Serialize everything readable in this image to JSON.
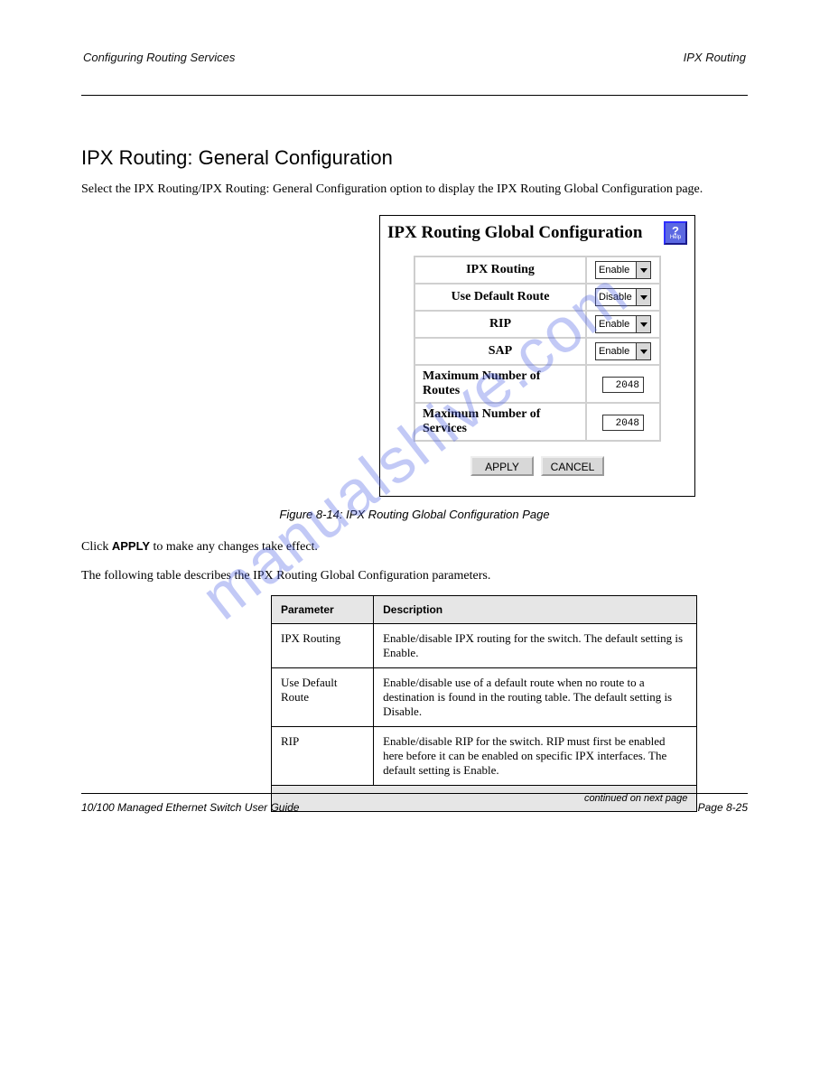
{
  "header": {
    "left": "Configuring Routing Services",
    "right": "IPX Routing"
  },
  "section_heading": "IPX Routing: General Configuration",
  "intro": "Select the IPX Routing/IPX Routing: General Configuration option to display the IPX Routing Global Configuration page.",
  "ui": {
    "title": "IPX Routing Global Configuration",
    "help_icon": "?",
    "help_label": "Help",
    "rows": [
      {
        "label": "IPX Routing",
        "kind": "select",
        "value": "Enable"
      },
      {
        "label": "Use Default Route",
        "kind": "select",
        "value": "Disable"
      },
      {
        "label": "RIP",
        "kind": "select",
        "value": "Enable"
      },
      {
        "label": "SAP",
        "kind": "select",
        "value": "Enable"
      },
      {
        "label": "Maximum Number of Routes",
        "kind": "input",
        "value": "2048"
      },
      {
        "label": "Maximum Number of Services",
        "kind": "input",
        "value": "2048"
      }
    ],
    "apply_label": "APPLY",
    "cancel_label": "CANCEL"
  },
  "figure_caption": "Figure 8-14: IPX Routing Global Configuration Page",
  "click_instruction_prefix": "Click ",
  "click_instruction_apply": "APPLY",
  "click_instruction_suffix": " to make any changes take effect.",
  "param_heading": "The following table describes the IPX Routing Global Configuration parameters.",
  "param_table": {
    "headers": {
      "param": "Parameter",
      "desc": "Description"
    },
    "rows": [
      {
        "param": "IPX Routing",
        "desc": "Enable/disable IPX routing for the switch. The default setting is Enable."
      },
      {
        "param": "Use Default Route",
        "desc": "Enable/disable use of a default route when no route to a destination is found in the routing table. The default setting is Disable."
      },
      {
        "param": "RIP",
        "desc": "Enable/disable RIP for the switch. RIP must first be enabled here before it can be enabled on specific IPX interfaces. The default setting is Enable."
      }
    ],
    "continued": "continued on next page"
  },
  "footer": {
    "left": "10/100 Managed Ethernet Switch User Guide",
    "right": "Page 8-25"
  },
  "watermark": "manualshive.com"
}
